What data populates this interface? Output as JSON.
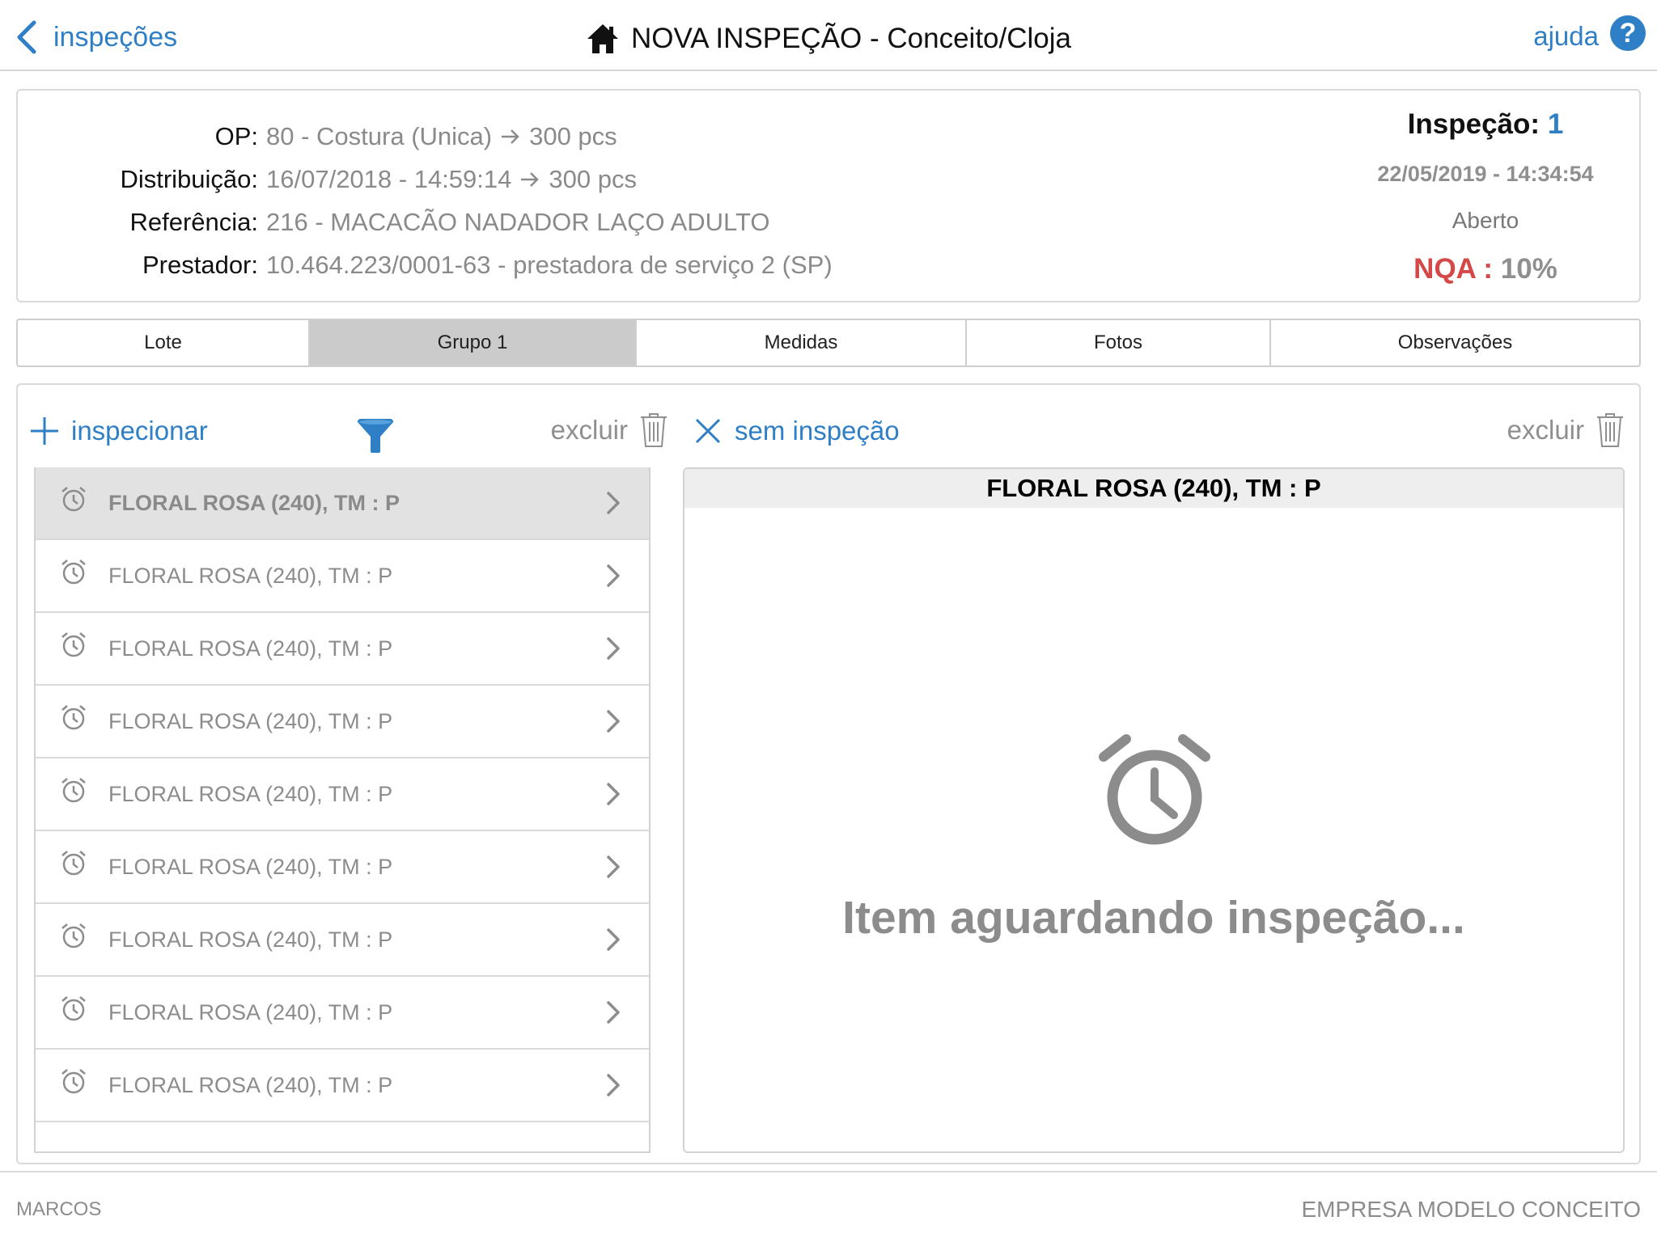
{
  "nav": {
    "back_label": "inspeções",
    "title": "NOVA INSPEÇÃO - Conceito/Cloja",
    "help_label": "ajuda",
    "help_symbol": "?"
  },
  "header": {
    "rows": [
      {
        "label": "OP:",
        "value": "80 - Costura (Unica)",
        "qty": "300 pcs"
      },
      {
        "label": "Distribuição:",
        "value": "16/07/2018 - 14:59:14",
        "qty": "300 pcs"
      },
      {
        "label": "Referência:",
        "value": "216 - MACACÃO NADADOR LAÇO ADULTO"
      },
      {
        "label": "Prestador:",
        "value": "10.464.223/0001-63 - prestadora de serviço 2 (SP)"
      }
    ],
    "inspection_label": "Inspeção:",
    "inspection_number": "1",
    "inspection_datetime": "22/05/2019 - 14:34:54",
    "status": "Aberto",
    "nqa_label": "NQA :",
    "nqa_value": "10%"
  },
  "tabs": [
    {
      "label": "Lote",
      "active": false
    },
    {
      "label": "Grupo 1",
      "active": true
    },
    {
      "label": "Medidas",
      "active": false
    },
    {
      "label": "Fotos",
      "active": false
    },
    {
      "label": "Observações",
      "active": false
    }
  ],
  "toolbar_left": {
    "add_label": "inspecionar",
    "delete_label": "excluir"
  },
  "toolbar_right": {
    "skip_label": "sem inspeção",
    "delete_label": "excluir"
  },
  "items": [
    {
      "label": "FLORAL ROSA (240), TM : P",
      "selected": true
    },
    {
      "label": "FLORAL ROSA (240), TM : P",
      "selected": false
    },
    {
      "label": "FLORAL ROSA (240), TM : P",
      "selected": false
    },
    {
      "label": "FLORAL ROSA (240), TM : P",
      "selected": false
    },
    {
      "label": "FLORAL ROSA (240), TM : P",
      "selected": false
    },
    {
      "label": "FLORAL ROSA (240), TM : P",
      "selected": false
    },
    {
      "label": "FLORAL ROSA (240), TM : P",
      "selected": false
    },
    {
      "label": "FLORAL ROSA (240), TM : P",
      "selected": false
    },
    {
      "label": "FLORAL ROSA (240), TM : P",
      "selected": false
    }
  ],
  "detail": {
    "title": "FLORAL ROSA (240), TM : P",
    "message": "Item aguardando inspeção..."
  },
  "footer": {
    "user": "MARCOS",
    "company": "EMPRESA MODELO CONCEITO"
  },
  "colors": {
    "accent": "#2f7fc7",
    "nqa_red": "#d44848",
    "muted_text": "#8c8c8c",
    "tab_active_bg": "#cbcbcb",
    "selected_row_bg": "#e2e2e2"
  }
}
